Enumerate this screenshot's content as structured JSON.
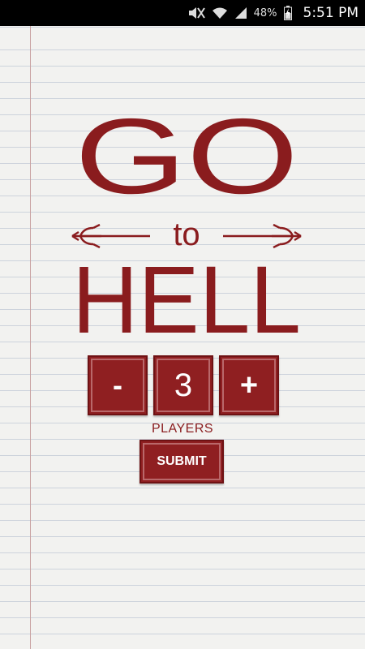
{
  "status_bar": {
    "battery": "48%",
    "time": "5:51 PM",
    "icons": [
      "mute-icon",
      "wifi-icon",
      "signal-icon",
      "battery-charging-icon"
    ]
  },
  "logo": {
    "line1": "GO",
    "line2": "to",
    "line3": "HELL",
    "color": "#8a1c1e"
  },
  "player_counter": {
    "decrement_label": "-",
    "value": "3",
    "increment_label": "+",
    "caption": "PLAYERS"
  },
  "submit": {
    "label": "SUBMIT"
  },
  "colors": {
    "accent": "#8f1f21",
    "margin_line": "#c9a2a2",
    "rule_lines": "#cdd3dc"
  }
}
